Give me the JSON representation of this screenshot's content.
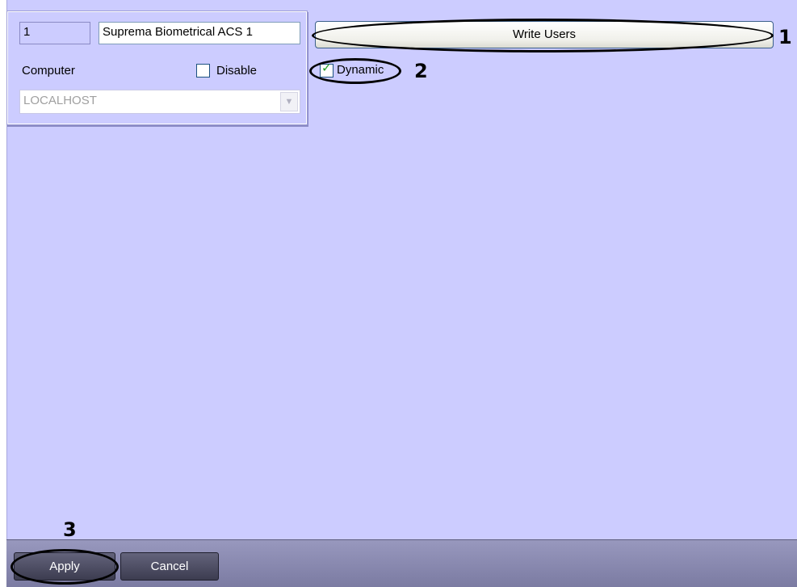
{
  "device": {
    "id": "1",
    "name": "Suprema Biometrical ACS 1",
    "computer_label": "Computer",
    "disable_label": "Disable",
    "computer_value": "LOCALHOST"
  },
  "actions": {
    "write_users_label": "Write Users",
    "dynamic_label": "Dynamic",
    "dynamic_checked": true
  },
  "callouts": {
    "one": "1",
    "two": "2",
    "three": "3"
  },
  "footer": {
    "apply_label": "Apply",
    "cancel_label": "Cancel"
  },
  "colors": {
    "panel": "#ccccff",
    "footer": "#8a8ab0",
    "button": "#505066"
  }
}
